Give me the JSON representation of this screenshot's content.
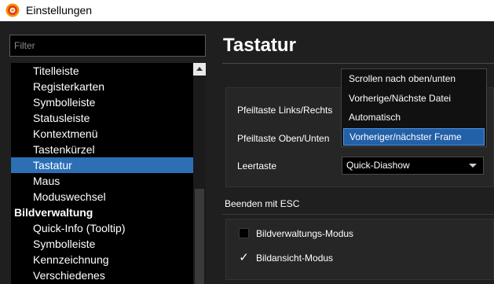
{
  "window": {
    "title": "Einstellungen",
    "icon": "app-flower-icon"
  },
  "sidebar": {
    "filter_placeholder": "Filter",
    "items": [
      {
        "label": "Titelleiste",
        "type": "item"
      },
      {
        "label": "Registerkarten",
        "type": "item"
      },
      {
        "label": "Symbolleiste",
        "type": "item"
      },
      {
        "label": "Statusleiste",
        "type": "item"
      },
      {
        "label": "Kontextmenü",
        "type": "item"
      },
      {
        "label": "Tastenkürzel",
        "type": "item"
      },
      {
        "label": "Tastatur",
        "type": "item",
        "selected": true
      },
      {
        "label": "Maus",
        "type": "item"
      },
      {
        "label": "Moduswechsel",
        "type": "item"
      },
      {
        "label": "Bildverwaltung",
        "type": "category"
      },
      {
        "label": "Quick-Info (Tooltip)",
        "type": "item"
      },
      {
        "label": "Symbolleiste",
        "type": "item"
      },
      {
        "label": "Kennzeichnung",
        "type": "item"
      },
      {
        "label": "Verschiedenes",
        "type": "item"
      }
    ]
  },
  "main": {
    "heading": "Tastatur",
    "rows": [
      {
        "label": "Pfeiltaste Links/Rechts"
      },
      {
        "label": "Pfeiltaste Oben/Unten"
      },
      {
        "label": "Leertaste",
        "value": "Quick-Diashow"
      }
    ],
    "dropdown": {
      "options": [
        "Scrollen nach oben/unten",
        "Vorherige/Nächste Datei",
        "Automatisch",
        "Vorheriger/nächster Frame"
      ],
      "selected_option": "Vorheriger/nächster Frame"
    },
    "esc_section": {
      "title": "Beenden mit ESC",
      "checkboxes": [
        {
          "label": "Bildverwaltungs-Modus",
          "checked": false
        },
        {
          "label": "Bildansicht-Modus",
          "checked": true
        }
      ]
    }
  },
  "colors": {
    "selection": "#2c6fb5",
    "background": "#1f1f1f",
    "panel": "#262626"
  }
}
